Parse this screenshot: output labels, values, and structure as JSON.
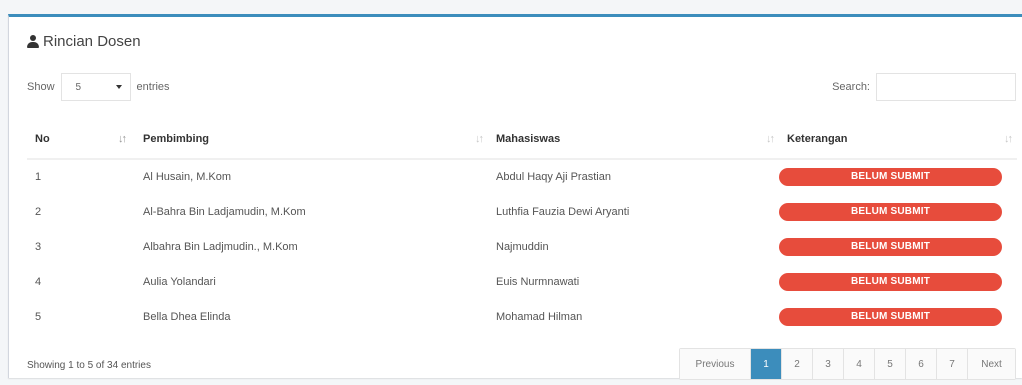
{
  "box": {
    "title": "Rincian Dosen",
    "title_icon": "user-icon"
  },
  "length_control": {
    "show_label": "Show",
    "selected": "5",
    "entries_label": "entries"
  },
  "search": {
    "label": "Search:",
    "value": ""
  },
  "table": {
    "headers": {
      "no": "No",
      "pembimbing": "Pembimbing",
      "mahasiswa": "Mahasiswas",
      "keterangan": "Keterangan"
    },
    "rows": [
      {
        "no": "1",
        "pembimbing": "Al Husain, M.Kom",
        "mahasiswa": "Abdul Haqy Aji Prastian",
        "keterangan": "BELUM SUBMIT"
      },
      {
        "no": "2",
        "pembimbing": "Al-Bahra Bin Ladjamudin, M.Kom",
        "mahasiswa": "Luthfia Fauzia Dewi Aryanti",
        "keterangan": "BELUM SUBMIT"
      },
      {
        "no": "3",
        "pembimbing": "Albahra Bin Ladjmudin., M.Kom",
        "mahasiswa": "Najmuddin",
        "keterangan": "BELUM SUBMIT"
      },
      {
        "no": "4",
        "pembimbing": "Aulia Yolandari",
        "mahasiswa": "Euis Nurmnawati",
        "keterangan": "BELUM SUBMIT"
      },
      {
        "no": "5",
        "pembimbing": "Bella Dhea Elinda",
        "mahasiswa": "Mohamad Hilman",
        "keterangan": "BELUM SUBMIT"
      }
    ]
  },
  "info": "Showing 1 to 5 of 34 entries",
  "pagination": {
    "previous": "Previous",
    "pages": [
      "1",
      "2",
      "3",
      "4",
      "5",
      "6",
      "7"
    ],
    "active_page": "1",
    "next": "Next"
  },
  "colors": {
    "accent": "#3c8dbc",
    "badge": "#e74c3c"
  }
}
